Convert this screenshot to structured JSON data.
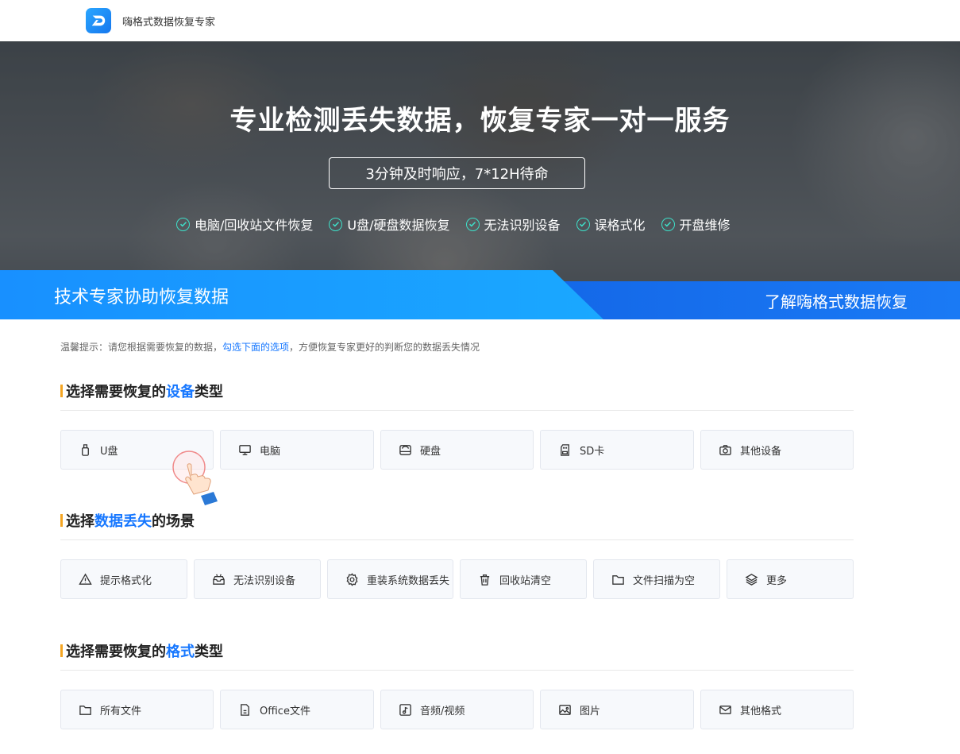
{
  "header": {
    "brand": "嗨格式数据恢复专家"
  },
  "hero": {
    "title": "专业检测丢失数据，恢复专家一对一服务",
    "pill": "3分钟及时响应，7*12H待命",
    "features": [
      "电脑/回收站文件恢复",
      "U盘/硬盘数据恢复",
      "无法识别设备",
      "误格式化",
      "开盘维修"
    ]
  },
  "strip": {
    "left": "技术专家协助恢复数据",
    "right": "了解嗨格式数据恢复"
  },
  "tip": {
    "prefix": "温馨提示：请您根据需要恢复的数据，",
    "highlight": "勾选下面的选项",
    "suffix": "，方便恢复专家更好的判断您的数据丢失情况"
  },
  "sections": {
    "device": {
      "pre": "选择需要恢复的",
      "blue": "设备",
      "post": "类型",
      "options": [
        {
          "label": "U盘",
          "icon": "usb-icon"
        },
        {
          "label": "电脑",
          "icon": "monitor-icon"
        },
        {
          "label": "硬盘",
          "icon": "harddisk-icon"
        },
        {
          "label": "SD卡",
          "icon": "sdcard-icon"
        },
        {
          "label": "其他设备",
          "icon": "camera-icon"
        }
      ]
    },
    "scene": {
      "pre": "选择",
      "blue": "数据丢失",
      "post": "的场景",
      "options": [
        {
          "label": "提示格式化",
          "icon": "warning-icon"
        },
        {
          "label": "无法识别设备",
          "icon": "inbox-icon"
        },
        {
          "label": "重装系统数据丢失",
          "icon": "gear-icon"
        },
        {
          "label": "回收站清空",
          "icon": "trash-icon"
        },
        {
          "label": "文件扫描为空",
          "icon": "folder-icon"
        },
        {
          "label": "更多",
          "icon": "layers-icon"
        }
      ]
    },
    "format": {
      "pre": "选择需要恢复的",
      "blue": "格式",
      "post": "类型",
      "options": [
        {
          "label": "所有文件",
          "icon": "folder-icon"
        },
        {
          "label": "Office文件",
          "icon": "document-icon"
        },
        {
          "label": "音频/视频",
          "icon": "music-icon"
        },
        {
          "label": "图片",
          "icon": "image-icon"
        },
        {
          "label": "其他格式",
          "icon": "mail-icon"
        }
      ]
    }
  }
}
